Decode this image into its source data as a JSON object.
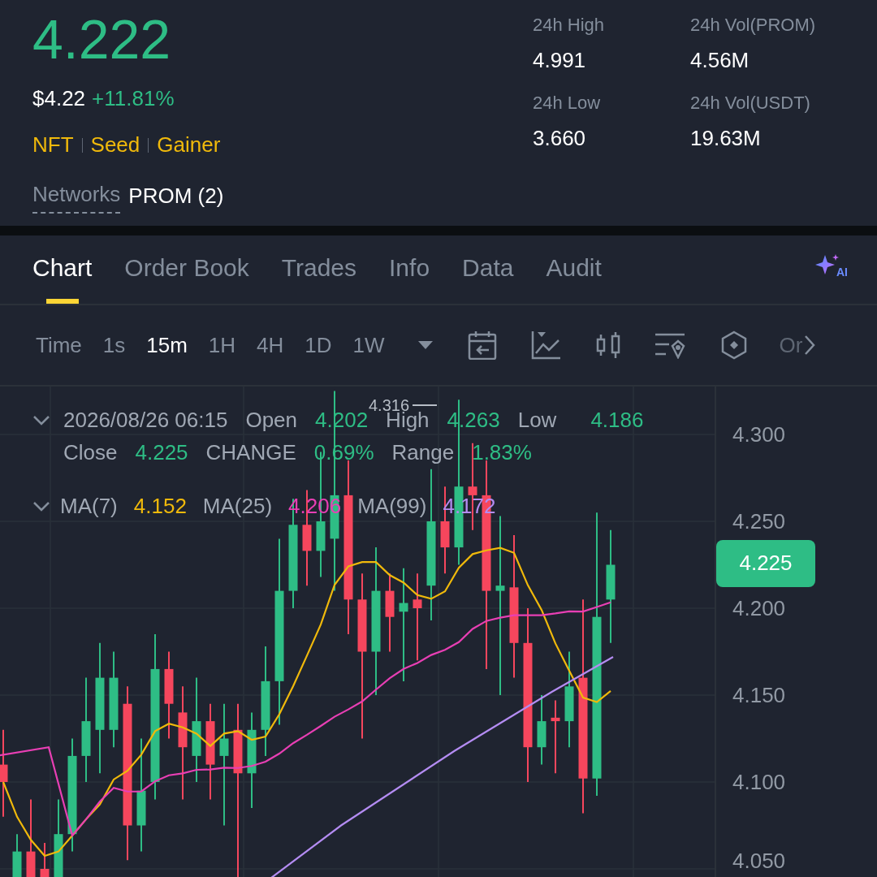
{
  "ticker": {
    "price": "4.222",
    "fiat_price": "$4.22",
    "change": "+11.81%",
    "tags": [
      "NFT",
      "Seed",
      "Gainer"
    ],
    "networks_label": "Networks",
    "networks_value": "PROM (2)"
  },
  "stats": [
    {
      "label": "24h High",
      "value": "4.991"
    },
    {
      "label": "24h Vol(PROM)",
      "value": "4.56M"
    },
    {
      "label": "24h Low",
      "value": "3.660"
    },
    {
      "label": "24h Vol(USDT)",
      "value": "19.63M"
    }
  ],
  "tabs": [
    {
      "label": "Chart",
      "selected": true
    },
    {
      "label": "Order Book",
      "selected": false
    },
    {
      "label": "Trades",
      "selected": false
    },
    {
      "label": "Info",
      "selected": false
    },
    {
      "label": "Data",
      "selected": false
    },
    {
      "label": "Audit",
      "selected": false
    }
  ],
  "ai_label": "AI",
  "interval_label": "Time",
  "intervals": [
    {
      "label": "1s",
      "selected": false
    },
    {
      "label": "15m",
      "selected": true
    },
    {
      "label": "1H",
      "selected": false
    },
    {
      "label": "4H",
      "selected": false
    },
    {
      "label": "1D",
      "selected": false
    },
    {
      "label": "1W",
      "selected": false
    }
  ],
  "toolbar_more": "Or",
  "legend": {
    "date": "2026/08/26 06:15",
    "fields": [
      {
        "label": "Open",
        "value": "4.202"
      },
      {
        "label": "High",
        "value": "4.263"
      },
      {
        "label": "Low",
        "value": "4.186"
      },
      {
        "label": "Close",
        "value": "4.225"
      },
      {
        "label": "CHANGE",
        "value": "0.69%"
      },
      {
        "label": "Range",
        "value": "1.83%"
      }
    ]
  },
  "moving_averages": [
    {
      "label": "MA(7)",
      "value": "4.152",
      "color": "#f0b90b"
    },
    {
      "label": "MA(25)",
      "value": "4.206",
      "color": "#e83fb4"
    },
    {
      "label": "MA(99)",
      "value": "4.172",
      "color": "#b48cf2"
    }
  ],
  "chart": {
    "max_label": "4.316",
    "price_axis": [
      "4.300",
      "4.250",
      "4.200",
      "4.150",
      "4.100",
      "4.050"
    ],
    "last_price": "4.225"
  }
}
